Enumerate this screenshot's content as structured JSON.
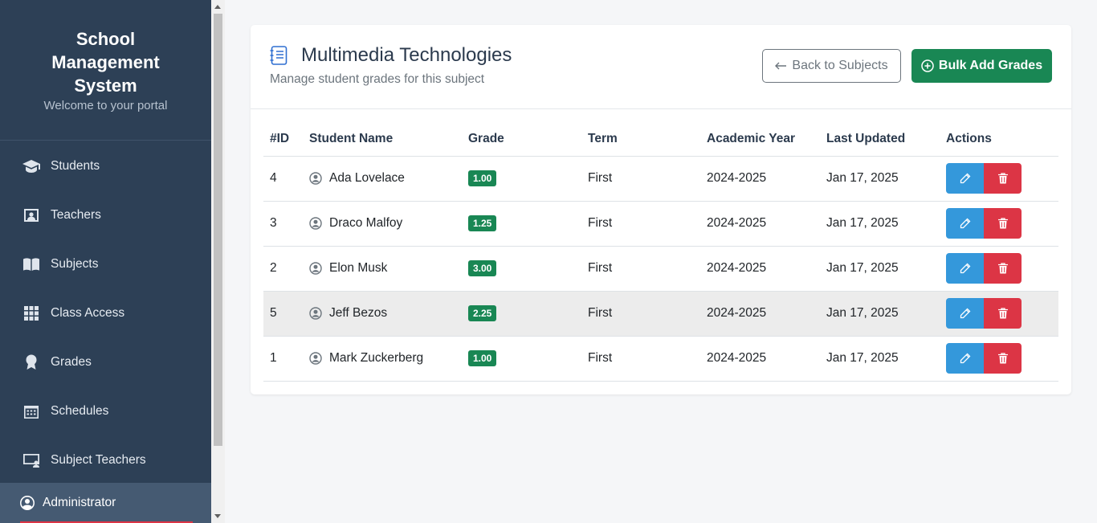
{
  "sidebar": {
    "brand_title_1": "School",
    "brand_title_2": "Management",
    "brand_title_3": "System",
    "brand_sub": "Welcome to your portal",
    "items": [
      {
        "label": "Students",
        "icon": "graduation-cap-icon"
      },
      {
        "label": "Teachers",
        "icon": "teacher-board-icon"
      },
      {
        "label": "Subjects",
        "icon": "book-icon"
      },
      {
        "label": "Class Access",
        "icon": "grid-icon"
      },
      {
        "label": "Grades",
        "icon": "award-icon"
      },
      {
        "label": "Schedules",
        "icon": "calendar-icon"
      },
      {
        "label": "Subject Teachers",
        "icon": "presenter-icon"
      }
    ],
    "user": "Administrator"
  },
  "header": {
    "title": "Multimedia Technologies",
    "subtitle": "Manage student grades for this subject",
    "back_label": "Back to Subjects",
    "bulk_label": "Bulk Add Grades"
  },
  "table": {
    "columns": [
      "#ID",
      "Student Name",
      "Grade",
      "Term",
      "Academic Year",
      "Last Updated",
      "Actions"
    ],
    "rows": [
      {
        "id": "4",
        "name": "Ada Lovelace",
        "grade": "1.00",
        "term": "First",
        "year": "2024-2025",
        "updated": "Jan 17, 2025"
      },
      {
        "id": "3",
        "name": "Draco Malfoy",
        "grade": "1.25",
        "term": "First",
        "year": "2024-2025",
        "updated": "Jan 17, 2025"
      },
      {
        "id": "2",
        "name": "Elon Musk",
        "grade": "3.00",
        "term": "First",
        "year": "2024-2025",
        "updated": "Jan 17, 2025"
      },
      {
        "id": "5",
        "name": "Jeff Bezos",
        "grade": "2.25",
        "term": "First",
        "year": "2024-2025",
        "updated": "Jan 17, 2025"
      },
      {
        "id": "1",
        "name": "Mark Zuckerberg",
        "grade": "1.00",
        "term": "First",
        "year": "2024-2025",
        "updated": "Jan 17, 2025"
      }
    ]
  },
  "colors": {
    "sidebar_bg": "#2d4056",
    "success": "#198754",
    "edit": "#3498db",
    "delete": "#dc3545"
  }
}
